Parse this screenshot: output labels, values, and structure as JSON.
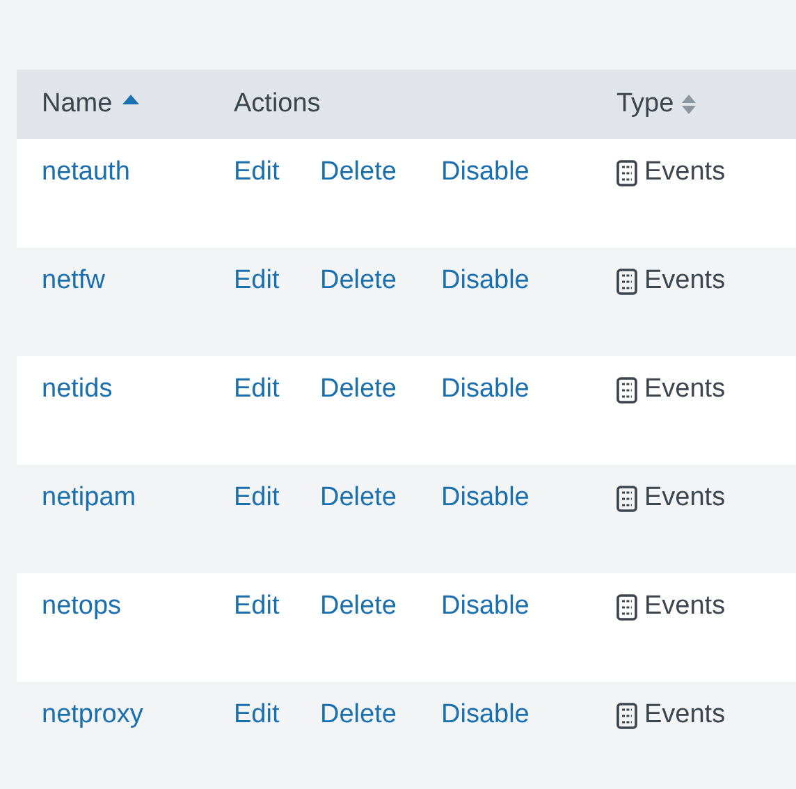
{
  "table": {
    "columns": [
      {
        "label": "Name",
        "sortable": true,
        "sorted": true
      },
      {
        "label": "Actions"
      },
      {
        "label": "Type",
        "sortable": true,
        "sorted": false
      }
    ],
    "rows": [
      {
        "name": "netauth",
        "actions": [
          "Edit",
          "Delete",
          "Disable"
        ],
        "type": "Events"
      },
      {
        "name": "netfw",
        "actions": [
          "Edit",
          "Delete",
          "Disable"
        ],
        "type": "Events"
      },
      {
        "name": "netids",
        "actions": [
          "Edit",
          "Delete",
          "Disable"
        ],
        "type": "Events"
      },
      {
        "name": "netipam",
        "actions": [
          "Edit",
          "Delete",
          "Disable"
        ],
        "type": "Events"
      },
      {
        "name": "netops",
        "actions": [
          "Edit",
          "Delete",
          "Disable"
        ],
        "type": "Events"
      },
      {
        "name": "netproxy",
        "actions": [
          "Edit",
          "Delete",
          "Disable"
        ],
        "type": "Events"
      }
    ]
  }
}
